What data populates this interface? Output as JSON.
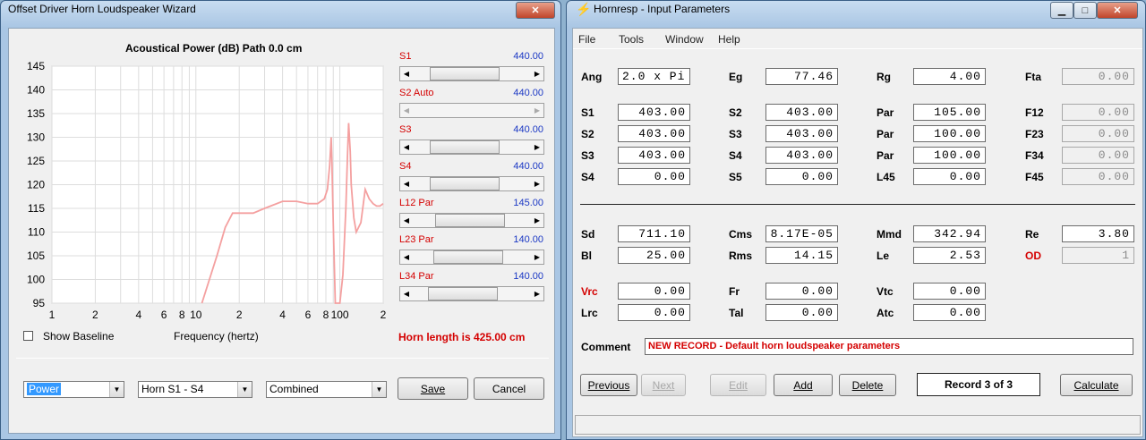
{
  "wizard": {
    "title": "Offset Driver Horn Loudspeaker Wizard",
    "chart_title": "Acoustical Power (dB)   Path 0.0 cm",
    "x_label": "Frequency (hertz)",
    "show_baseline_label": "Show Baseline",
    "show_baseline_checked": false,
    "horn_length": "Horn length is 425.00 cm",
    "sliders": [
      {
        "label": "S1",
        "value": "440.00",
        "pos": 0.35,
        "disabled": false
      },
      {
        "label": "S2 Auto",
        "value": "440.00",
        "pos": 0.0,
        "disabled": true
      },
      {
        "label": "S3",
        "value": "440.00",
        "pos": 0.35,
        "disabled": false
      },
      {
        "label": "S4",
        "value": "440.00",
        "pos": 0.35,
        "disabled": false
      },
      {
        "label": "L12 Par",
        "value": "145.00",
        "pos": 0.47,
        "disabled": false
      },
      {
        "label": "L23 Par",
        "value": "140.00",
        "pos": 0.42,
        "disabled": false
      },
      {
        "label": "L34 Par",
        "value": "140.00",
        "pos": 0.32,
        "disabled": false
      }
    ],
    "combos": {
      "mode": "Power",
      "section": "Horn S1 - S4",
      "type": "Combined"
    },
    "buttons": {
      "save": "Save",
      "cancel": "Cancel"
    }
  },
  "hornresp": {
    "title": "Hornresp - Input Parameters",
    "menu": [
      "File",
      "Tools",
      "Window",
      "Help"
    ],
    "fields": {
      "ang": {
        "label": "Ang",
        "value": "2.0 x Pi"
      },
      "eg": {
        "label": "Eg",
        "value": "77.46"
      },
      "rg": {
        "label": "Rg",
        "value": "4.00"
      },
      "fta": {
        "label": "Fta",
        "value": "0.00"
      },
      "r1_s1": {
        "label": "S1",
        "value": "403.00"
      },
      "r1_s2": {
        "label": "S2",
        "value": "403.00"
      },
      "r1_par": {
        "label": "Par",
        "value": "105.00"
      },
      "f12": {
        "label": "F12",
        "value": "0.00"
      },
      "r2_s2": {
        "label": "S2",
        "value": "403.00"
      },
      "r2_s3": {
        "label": "S3",
        "value": "403.00"
      },
      "r2_par": {
        "label": "Par",
        "value": "100.00"
      },
      "f23": {
        "label": "F23",
        "value": "0.00"
      },
      "r3_s3": {
        "label": "S3",
        "value": "403.00"
      },
      "r3_s4": {
        "label": "S4",
        "value": "403.00"
      },
      "r3_par": {
        "label": "Par",
        "value": "100.00"
      },
      "f34": {
        "label": "F34",
        "value": "0.00"
      },
      "r4_s4": {
        "label": "S4",
        "value": "0.00"
      },
      "r4_s5": {
        "label": "S5",
        "value": "0.00"
      },
      "l45": {
        "label": "L45",
        "value": "0.00"
      },
      "f45": {
        "label": "F45",
        "value": "0.00"
      },
      "sd": {
        "label": "Sd",
        "value": "711.10"
      },
      "cms": {
        "label": "Cms",
        "value": "8.17E-05"
      },
      "mmd": {
        "label": "Mmd",
        "value": "342.94"
      },
      "re": {
        "label": "Re",
        "value": "3.80"
      },
      "bl": {
        "label": "Bl",
        "value": "25.00"
      },
      "rms": {
        "label": "Rms",
        "value": "14.15"
      },
      "le": {
        "label": "Le",
        "value": "2.53"
      },
      "od": {
        "label": "OD",
        "value": "1"
      },
      "vrc": {
        "label": "Vrc",
        "value": "0.00"
      },
      "fr": {
        "label": "Fr",
        "value": "0.00"
      },
      "vtc": {
        "label": "Vtc",
        "value": "0.00"
      },
      "lrc": {
        "label": "Lrc",
        "value": "0.00"
      },
      "tal": {
        "label": "Tal",
        "value": "0.00"
      },
      "atc": {
        "label": "Atc",
        "value": "0.00"
      }
    },
    "comment_label": "Comment",
    "comment": "NEW RECORD - Default horn loudspeaker parameters",
    "buttons": {
      "previous": "Previous",
      "next": "Next",
      "edit": "Edit",
      "add": "Add",
      "delete": "Delete",
      "calculate": "Calculate"
    },
    "record": "Record 3 of 3"
  },
  "chart_data": {
    "type": "line",
    "title": "Acoustical Power (dB)   Path 0.0 cm",
    "xlabel": "Frequency (hertz)",
    "x_scale": "log",
    "xlim": [
      1,
      200
    ],
    "ylim": [
      95,
      145
    ],
    "y_ticks": [
      95,
      100,
      105,
      110,
      115,
      120,
      125,
      130,
      135,
      140,
      145
    ],
    "x_ticks": [
      {
        "v": 1,
        "l": "1"
      },
      {
        "v": 2,
        "l": "2"
      },
      {
        "v": 4,
        "l": "4"
      },
      {
        "v": 6,
        "l": "6"
      },
      {
        "v": 8,
        "l": "8"
      },
      {
        "v": 10,
        "l": "10"
      },
      {
        "v": 20,
        "l": "2"
      },
      {
        "v": 40,
        "l": "4"
      },
      {
        "v": 60,
        "l": "6"
      },
      {
        "v": 80,
        "l": "8"
      },
      {
        "v": 100,
        "l": "100"
      },
      {
        "v": 200,
        "l": "2"
      }
    ],
    "grid": true,
    "line_color": "#f4a0a0",
    "series": [
      {
        "x": [
          11,
          14,
          16,
          18,
          20,
          25,
          30,
          40,
          50,
          60,
          70,
          78,
          82,
          85,
          87,
          88,
          90,
          93,
          100,
          105,
          110,
          113,
          115,
          118,
          120,
          125,
          130,
          140,
          150,
          160,
          170,
          180,
          190,
          200
        ],
        "y": [
          95,
          105,
          111,
          114,
          114,
          114,
          115,
          116.5,
          116.5,
          116,
          116,
          117,
          119,
          124,
          130,
          125,
          112,
          95,
          95,
          101,
          115,
          126,
          133,
          127,
          120,
          113,
          110,
          112,
          119,
          117,
          116,
          115.5,
          115.5,
          116
        ]
      }
    ]
  }
}
